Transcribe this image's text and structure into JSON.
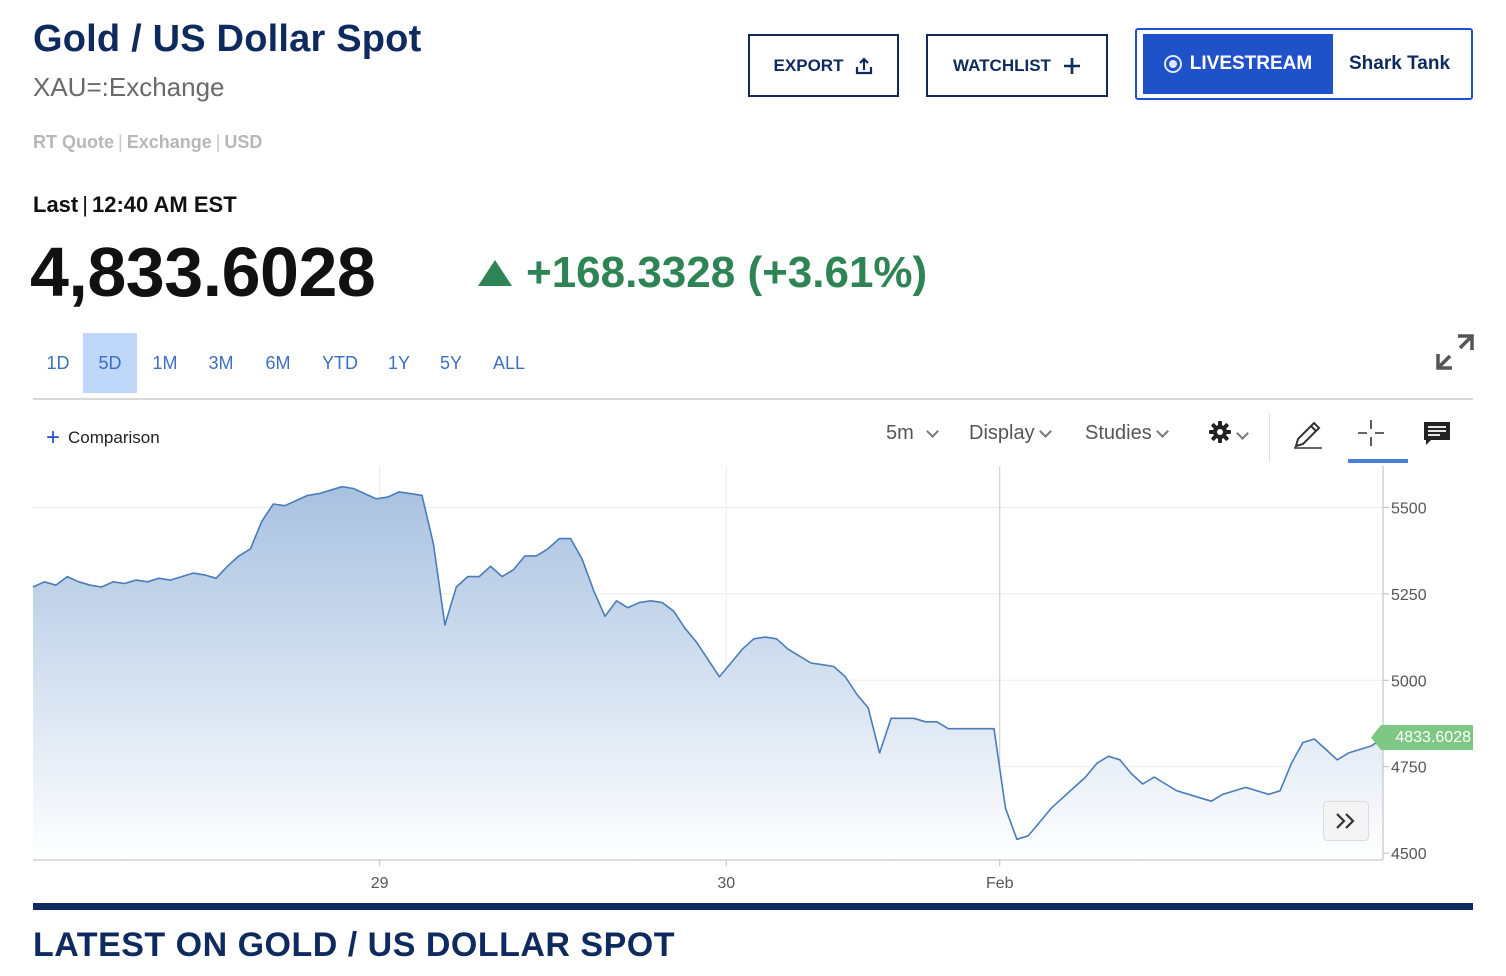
{
  "header": {
    "title": "Gold / US Dollar Spot",
    "symbol": "XAU=:Exchange",
    "quote_type": "RT Quote",
    "exchange": "Exchange",
    "currency": "USD"
  },
  "buttons": {
    "export_label": "EXPORT",
    "watchlist_label": "WATCHLIST",
    "livestream_label": "LIVESTREAM",
    "shark_tank_label": "Shark Tank"
  },
  "quote": {
    "last_label": "Last",
    "time": "12:40 AM EST",
    "price": "4,833.6028",
    "change": "+168.3328 (+3.61%)",
    "direction": "up",
    "change_color": "#2f8455"
  },
  "ranges": [
    {
      "label": "1D",
      "active": false
    },
    {
      "label": "5D",
      "active": true
    },
    {
      "label": "1M",
      "active": false
    },
    {
      "label": "3M",
      "active": false
    },
    {
      "label": "6M",
      "active": false
    },
    {
      "label": "YTD",
      "active": false
    },
    {
      "label": "1Y",
      "active": false
    },
    {
      "label": "5Y",
      "active": false
    },
    {
      "label": "ALL",
      "active": false
    }
  ],
  "toolbar": {
    "comparison_label": "Comparison",
    "interval": "5m",
    "display_label": "Display",
    "studies_label": "Studies",
    "icons": [
      "settings-icon",
      "pencil-icon",
      "crosshair-icon",
      "comment-icon"
    ],
    "active_tool": "crosshair"
  },
  "chart_data": {
    "type": "area",
    "x_ticks": [
      "29",
      "30",
      "Feb"
    ],
    "y_ticks": [
      5500,
      5250,
      5000,
      4750,
      4500
    ],
    "ylim": [
      4480,
      5620
    ],
    "grid": true,
    "last_value_label": "4833.6028",
    "colors": {
      "line": "#4a7cba",
      "fill_top": "#a8c1e0",
      "fill_bottom": "#ffffff",
      "last_tag": "#7fc785"
    },
    "series": [
      {
        "values": [
          5270,
          5285,
          5275,
          5300,
          5285,
          5275,
          5270,
          5285,
          5280,
          5290,
          5285,
          5295,
          5290,
          5300,
          5310,
          5305,
          5295,
          5330,
          5360,
          5380,
          5460,
          5510,
          5505,
          5520,
          5535,
          5540,
          5550,
          5560,
          5555,
          5540,
          5525,
          5530,
          5545,
          5540,
          5535,
          5395,
          5160,
          5270,
          5300,
          5300,
          5330,
          5300,
          5320,
          5360,
          5360,
          5380,
          5410,
          5410,
          5350,
          5260,
          5185,
          5230,
          5210,
          5225,
          5230,
          5225,
          5200,
          5150,
          5110,
          5060,
          5010,
          5050,
          5090,
          5120,
          5125,
          5120,
          5090,
          5070,
          5050,
          5045,
          5040,
          5010,
          4960,
          4920,
          4790,
          4890,
          4890,
          4890,
          4880,
          4880,
          4860,
          4860,
          4860,
          4860,
          4860,
          4630,
          4540,
          4550,
          4590,
          4630,
          4660,
          4690,
          4720,
          4760,
          4780,
          4770,
          4730,
          4700,
          4720,
          4700,
          4680,
          4670,
          4660,
          4650,
          4670,
          4680,
          4690,
          4680,
          4670,
          4680,
          4760,
          4820,
          4830,
          4800,
          4770,
          4790,
          4800,
          4810,
          4834
        ]
      }
    ]
  },
  "footer": {
    "latest_heading": "LATEST ON GOLD / US DOLLAR SPOT"
  }
}
